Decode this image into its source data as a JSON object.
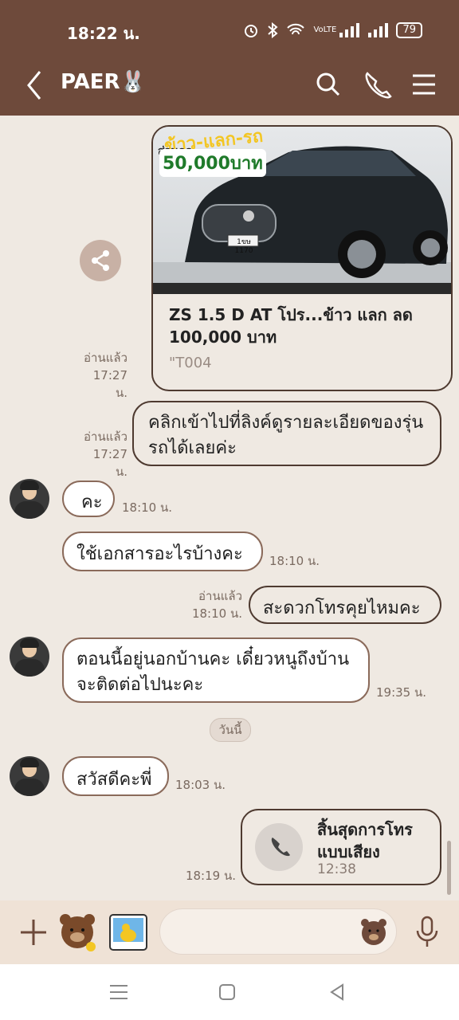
{
  "status": {
    "time": "18:22 น.",
    "battery": "79",
    "network_label": "VoLTE"
  },
  "header": {
    "contact_name": "PAER",
    "contact_emoji": "🐰"
  },
  "link_card": {
    "title": "ZS 1.5 D AT โปร...ข้าว แลก ลด 100,000 บาท",
    "subtitle": "\"T004",
    "image_text_top": "ข้าว-แลก-รถ",
    "image_text_discount_label": "ส่วนลด",
    "image_text_discount": "50,000บาท",
    "plate": "1ขษ 1170",
    "read_label": "อ่านแล้ว",
    "time": "17:27 น."
  },
  "messages": [
    {
      "id": "m1",
      "side": "me",
      "text": "คลิกเข้าไปที่ลิงค์ดูรายละเอียดของรุ่นรถได้เลยค่ะ",
      "read": "อ่านแล้ว",
      "time": "17:27 น."
    },
    {
      "id": "m2",
      "side": "them",
      "text": "คะ",
      "time": "18:10 น."
    },
    {
      "id": "m3",
      "side": "them",
      "text": "ใช้เอกสารอะไรบ้างคะ",
      "time": "18:10 น."
    },
    {
      "id": "m4",
      "side": "me",
      "text": "สะดวกโทรคุยไหมคะ",
      "read": "อ่านแล้ว",
      "time": "18:10 น."
    },
    {
      "id": "m5",
      "side": "them",
      "text": "ตอนนี้อยู่นอกบ้านคะ เดี๋ยวหนูถึงบ้านจะติดต่อไปนะคะ",
      "time": "19:35 น."
    },
    {
      "id": "m6",
      "side": "them",
      "text": "สวัสดีคะพี่",
      "time": "18:03 น."
    }
  ],
  "date_divider": "วันนี้",
  "call": {
    "title": "สิ้นสุดการโทรแบบเสียง",
    "duration": "12:38",
    "time": "18:19 น."
  },
  "input": {
    "placeholder": ""
  }
}
